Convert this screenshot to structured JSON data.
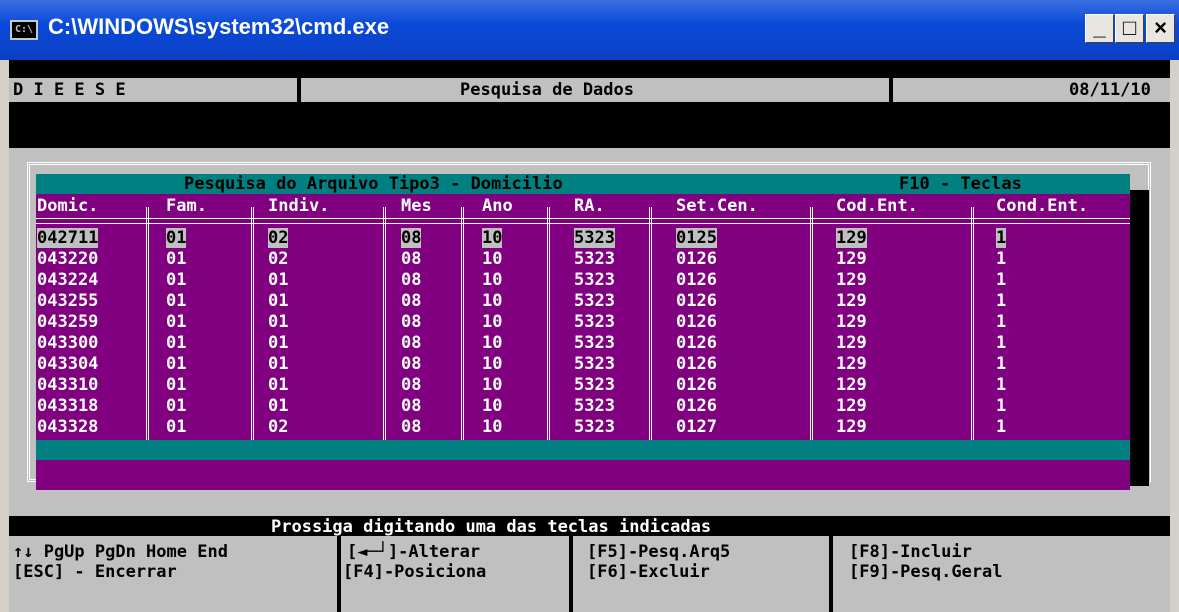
{
  "window": {
    "title": "C:\\WINDOWS\\system32\\cmd.exe",
    "icon_text": "C:\\",
    "minimize_label": "_",
    "maximize_label": "□",
    "close_label": "×"
  },
  "header": {
    "left": "D I E E S E",
    "center": "Pesquisa de Dados",
    "date": "08/11/10"
  },
  "grid": {
    "title": "Pesquisa do Arquivo Tipo3 - Domicilio",
    "hint": "F10 - Teclas",
    "columns": [
      "Domic.",
      "Fam.",
      "Indiv.",
      "Mes",
      "Ano",
      "RA.",
      "Set.Cen.",
      "Cod.Ent.",
      "Cond.Ent."
    ],
    "rows": [
      [
        "042711",
        "01",
        "02",
        "08",
        "10",
        "5323",
        "0125",
        "129",
        "1"
      ],
      [
        "043220",
        "01",
        "02",
        "08",
        "10",
        "5323",
        "0126",
        "129",
        "1"
      ],
      [
        "043224",
        "01",
        "01",
        "08",
        "10",
        "5323",
        "0126",
        "129",
        "1"
      ],
      [
        "043255",
        "01",
        "01",
        "08",
        "10",
        "5323",
        "0126",
        "129",
        "1"
      ],
      [
        "043259",
        "01",
        "01",
        "08",
        "10",
        "5323",
        "0126",
        "129",
        "1"
      ],
      [
        "043300",
        "01",
        "01",
        "08",
        "10",
        "5323",
        "0126",
        "129",
        "1"
      ],
      [
        "043304",
        "01",
        "01",
        "08",
        "10",
        "5323",
        "0126",
        "129",
        "1"
      ],
      [
        "043310",
        "01",
        "01",
        "08",
        "10",
        "5323",
        "0126",
        "129",
        "1"
      ],
      [
        "043318",
        "01",
        "01",
        "08",
        "10",
        "5323",
        "0126",
        "129",
        "1"
      ],
      [
        "043328",
        "01",
        "02",
        "08",
        "10",
        "5323",
        "0127",
        "129",
        "1"
      ]
    ]
  },
  "status": {
    "message": "Prossiga digitando uma das teclas indicadas"
  },
  "keys": {
    "nav": "↑↓ PgUp PgDn Home End",
    "esc": "[ESC] - Encerrar",
    "f_enter": "[◄─┘]-Alterar",
    "f4": "[F4]-Posiciona",
    "f5": "[F5]-Pesq.Arq5",
    "f6": "[F6]-Excluir",
    "f8": "[F8]-Incluir",
    "f9": "[F9]-Pesq.Geral"
  }
}
